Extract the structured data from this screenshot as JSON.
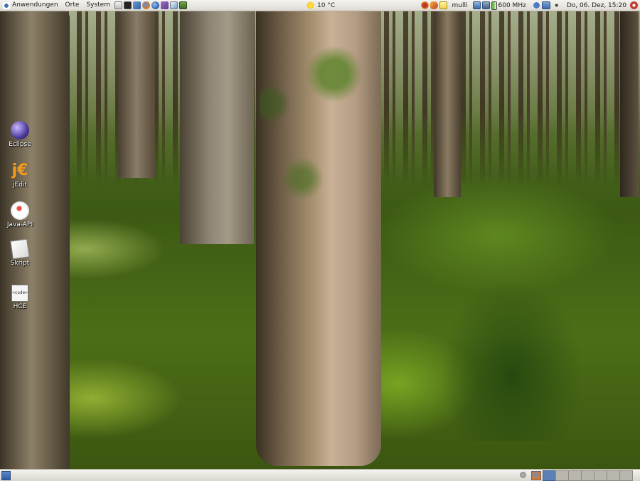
{
  "top_panel": {
    "menus": [
      "Anwendungen",
      "Orte",
      "System"
    ],
    "launchers": [
      "home-icon",
      "terminal-icon",
      "network-icon",
      "firefox-icon",
      "thunderbird-icon",
      "pidgin-icon",
      "image-icon",
      "calculator-icon"
    ],
    "weather": {
      "temperature": "10 °C",
      "icon": "weather-sun-icon"
    },
    "tray": {
      "icons": [
        "update-icon",
        "fish-icon",
        "notes-icon"
      ],
      "user": "mulli",
      "cpu_freq": "600 MHz",
      "clock": "Do, 06. Dez, 15:20",
      "volume_icon": "volume-icon",
      "power_icon": "power-icon"
    }
  },
  "desktop_icons": [
    {
      "label": "Eclipse",
      "icon": "eclipse-icon"
    },
    {
      "label": "jEdit",
      "icon": "jedit-icon"
    },
    {
      "label": "Java-API",
      "icon": "java-icon"
    },
    {
      "label": "Skript",
      "icon": "script-icon"
    },
    {
      "label": "HCE",
      "icon": "code-icon"
    }
  ],
  "bottom_panel": {
    "workspaces": 7,
    "active_workspace": 1
  }
}
